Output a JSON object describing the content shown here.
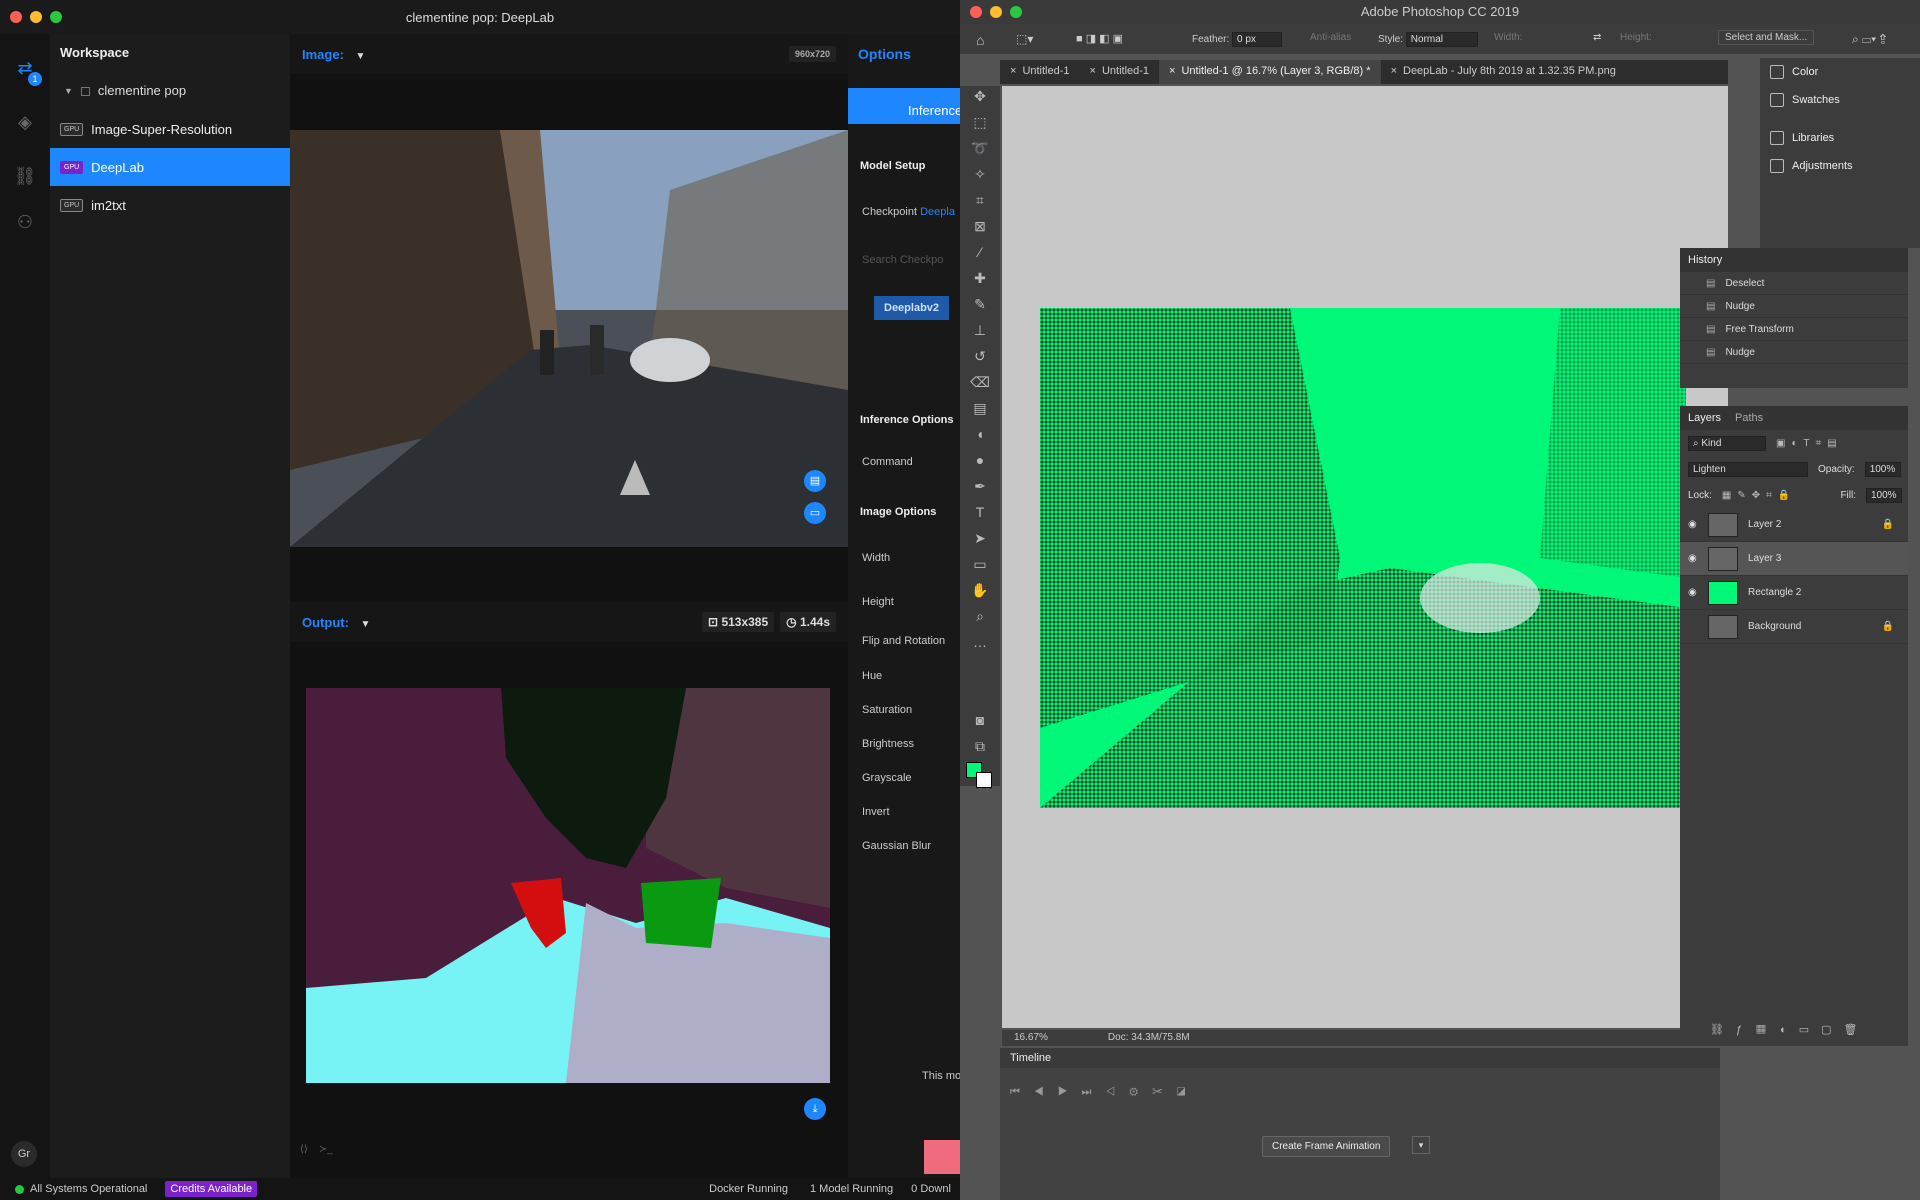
{
  "runway": {
    "window_title": "clementine pop: DeepLab",
    "workspace": {
      "title": "Workspace",
      "project": "clementine pop",
      "models": [
        {
          "tag": "GPU",
          "name": "Image-Super-Resolution",
          "selected": false
        },
        {
          "tag": "GPU",
          "name": "DeepLab",
          "selected": true
        },
        {
          "tag": "GPU",
          "name": "im2txt",
          "selected": false
        }
      ]
    },
    "rail": {
      "badge": "1",
      "user_initials": "Gr"
    },
    "input": {
      "label": "Image:",
      "resolution": "960x720"
    },
    "output": {
      "label": "Output:",
      "size": "513x385",
      "time": "1.44s"
    },
    "options": {
      "title": "Options",
      "active_tab": "Inference",
      "model_setup": "Model Setup",
      "checkpoint_label": "Checkpoint",
      "checkpoint_value": "Deepla",
      "search_placeholder": "Search Checkpo",
      "checkpoint_btn": "Deeplabv2",
      "inference_options": "Inference Options",
      "command": "Command",
      "image_options": "Image Options",
      "fields": [
        "Width",
        "Height",
        "Flip and Rotation",
        "Hue",
        "Saturation",
        "Brightness",
        "Grayscale",
        "Invert",
        "Gaussian Blur"
      ],
      "footer_text": "This mo"
    },
    "status": {
      "systems": "All Systems Operational",
      "credits": "Credits Available",
      "docker": "Docker Running",
      "models": "1 Model Running",
      "downloads": "0 Downl"
    }
  },
  "ps": {
    "window_title": "Adobe Photoshop CC 2019",
    "options": {
      "feather_label": "Feather:",
      "feather": "0 px",
      "antialias": "Anti-alias",
      "style_label": "Style:",
      "style": "Normal",
      "width_label": "Width:",
      "height_label": "Height:",
      "select_mask": "Select and Mask..."
    },
    "tabs": [
      "Untitled-1",
      "Untitled-1",
      "Untitled-1 @ 16.7% (Layer 3, RGB/8) *",
      "DeepLab - July 8th 2019 at 1.32.35 PM.png"
    ],
    "right_panels": [
      "Color",
      "Swatches",
      "Libraries",
      "Adjustments"
    ],
    "history": {
      "title": "History",
      "items": [
        "Deselect",
        "Nudge",
        "Free Transform",
        "Nudge"
      ]
    },
    "layers": {
      "tab1": "Layers",
      "tab2": "Paths",
      "kind": "Kind",
      "blend": "Lighten",
      "opacity_label": "Opacity:",
      "opacity": "100%",
      "lock_label": "Lock:",
      "fill_label": "Fill:",
      "fill": "100%",
      "items": [
        {
          "name": "Layer 2",
          "visible": true,
          "locked": true,
          "selected": false
        },
        {
          "name": "Layer 3",
          "visible": true,
          "locked": false,
          "selected": true
        },
        {
          "name": "Rectangle 2",
          "visible": true,
          "locked": false,
          "selected": false
        },
        {
          "name": "Background",
          "visible": false,
          "locked": true,
          "selected": false
        }
      ]
    },
    "status": {
      "zoom": "16.67%",
      "doc": "Doc: 34.3M/75.8M"
    },
    "timeline": {
      "title": "Timeline",
      "create": "Create Frame Animation"
    },
    "colors": {
      "fg": "#00f777",
      "bg": "#ffffff"
    }
  }
}
